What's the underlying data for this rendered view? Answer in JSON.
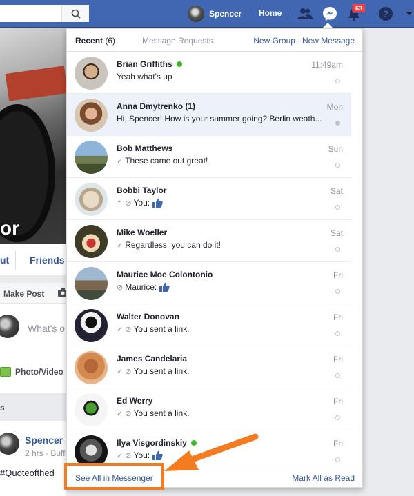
{
  "topbar": {
    "profile_name": "Spencer",
    "home_label": "Home",
    "notification_count": "63",
    "colors": {
      "bar": "#4267b2",
      "badge": "#fa3e3e"
    }
  },
  "page": {
    "cover_name_fragment": "or",
    "tab_fragment": "ut",
    "tab_friends": "Friends",
    "make_post": "Make Post",
    "composer_placeholder": "What's o",
    "photo_video": "Photo/Video",
    "feed_label": "s",
    "post_author": "Spencer",
    "post_meta": "2 hrs · Buff",
    "post_hashtag": "#Quoteofthed"
  },
  "messenger": {
    "tab_recent": "Recent",
    "tab_recent_count": "(6)",
    "tab_requests": "Message Requests",
    "new_group": "New Group",
    "separator": "·",
    "new_message": "New Message",
    "see_all": "See All in Messenger",
    "mark_all_read": "Mark All as Read",
    "conversations": [
      {
        "name": "Brian Griffiths",
        "online": true,
        "snippet": "Yeah what's up",
        "time": "11:49am",
        "icons": "",
        "unread": false,
        "avatar": "brian"
      },
      {
        "name": "Anna Dmytrenko (1)",
        "online": false,
        "snippet": "Hi, Spencer! How is your summer going? Berlin weath...",
        "time": "Mon",
        "icons": "",
        "unread": true,
        "avatar": "anna"
      },
      {
        "name": "Bob Matthews",
        "online": false,
        "snippet": "These came out great!",
        "time": "Sun",
        "icons": "✓",
        "unread": false,
        "avatar": "bob"
      },
      {
        "name": "Bobbi Taylor",
        "online": false,
        "snippet": "You:",
        "time": "Sat",
        "icons": "↰ ⊘",
        "thumbs": true,
        "unread": false,
        "avatar": "bobbi"
      },
      {
        "name": "Mike Woeller",
        "online": false,
        "snippet": "Regardless, you can do it!",
        "time": "Sat",
        "icons": "✓",
        "unread": false,
        "avatar": "mike"
      },
      {
        "name": "Maurice Moe Colontonio",
        "online": false,
        "snippet": "Maurice:",
        "time": "Fri",
        "icons": "⊘",
        "thumbs": true,
        "unread": false,
        "avatar": "maurice"
      },
      {
        "name": "Walter Donovan",
        "online": false,
        "snippet": "You sent a link.",
        "time": "Fri",
        "icons": "✓ ⊘",
        "unread": false,
        "avatar": "walter"
      },
      {
        "name": "James Candelaria",
        "online": false,
        "snippet": "You sent a link.",
        "time": "Fri",
        "icons": "✓ ⊘",
        "unread": false,
        "avatar": "james"
      },
      {
        "name": "Ed Werry",
        "online": false,
        "snippet": "You sent a link.",
        "time": "Fri",
        "icons": "✓ ⊘",
        "unread": false,
        "avatar": "ed"
      },
      {
        "name": "Ilya Visgordinskiy",
        "online": true,
        "snippet": "You:",
        "time": "Fri",
        "icons": "✓ ⊘",
        "thumbs": true,
        "unread": false,
        "avatar": "ilya"
      }
    ],
    "colors": {
      "link": "#365899",
      "online": "#42b72a",
      "unread_bg": "#edf2fa"
    }
  },
  "annotation": {
    "color": "#f47b20"
  }
}
